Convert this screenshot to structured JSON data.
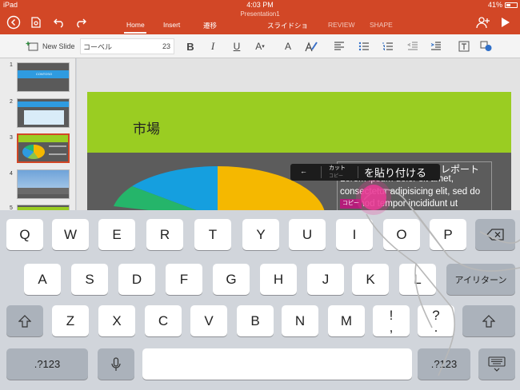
{
  "status": {
    "carrier": "iPad",
    "time": "4:03 PM",
    "battery": "41%"
  },
  "ribbon": {
    "doc_title": "Presentation1",
    "tabs": [
      {
        "label": "Home",
        "active": true
      },
      {
        "label": "Insert",
        "active": false
      },
      {
        "label": "遷移",
        "active": false
      },
      {
        "label": "スライドショ",
        "active": false
      },
      {
        "label": "REVIEW",
        "active": false
      },
      {
        "label": "SHAPE",
        "active": false
      }
    ]
  },
  "toolbar": {
    "new_slide_label": "New Slide",
    "font_name": "コーベル",
    "font_size": "23"
  },
  "slides_panel": {
    "numbers": [
      "1",
      "2",
      "3",
      "4",
      "5"
    ],
    "thumb1_title": "CONTOSO"
  },
  "slide": {
    "title": "市場",
    "body_lines": [
      "Lorem ipsum dolor sit amet,",
      "consectetur adipisicing elit, sed do",
      "eiusmod tempor incididunt ut"
    ],
    "report_label": "レポート",
    "copy_tag": "コピー",
    "colors": {
      "header": "#9acd22",
      "dark": "#5c5c5c"
    }
  },
  "context_menu": {
    "item1": "←",
    "item2": "カット",
    "item2_sub": "コピー",
    "item3": "を貼り付ける"
  },
  "keyboard": {
    "row1": [
      "Q",
      "W",
      "E",
      "R",
      "T",
      "Y",
      "U",
      "I",
      "O",
      "P"
    ],
    "row2": [
      "A",
      "S",
      "D",
      "F",
      "G",
      "H",
      "J",
      "K",
      "L"
    ],
    "row3": [
      "Z",
      "X",
      "C",
      "V",
      "B",
      "N",
      "M",
      "!",
      ","
    ],
    "row3_extra": "?",
    "row3_extra2": ".",
    "return_label": "アイリターン",
    "numbers_label": ".?123",
    "numbers_label_right": ".?123"
  }
}
